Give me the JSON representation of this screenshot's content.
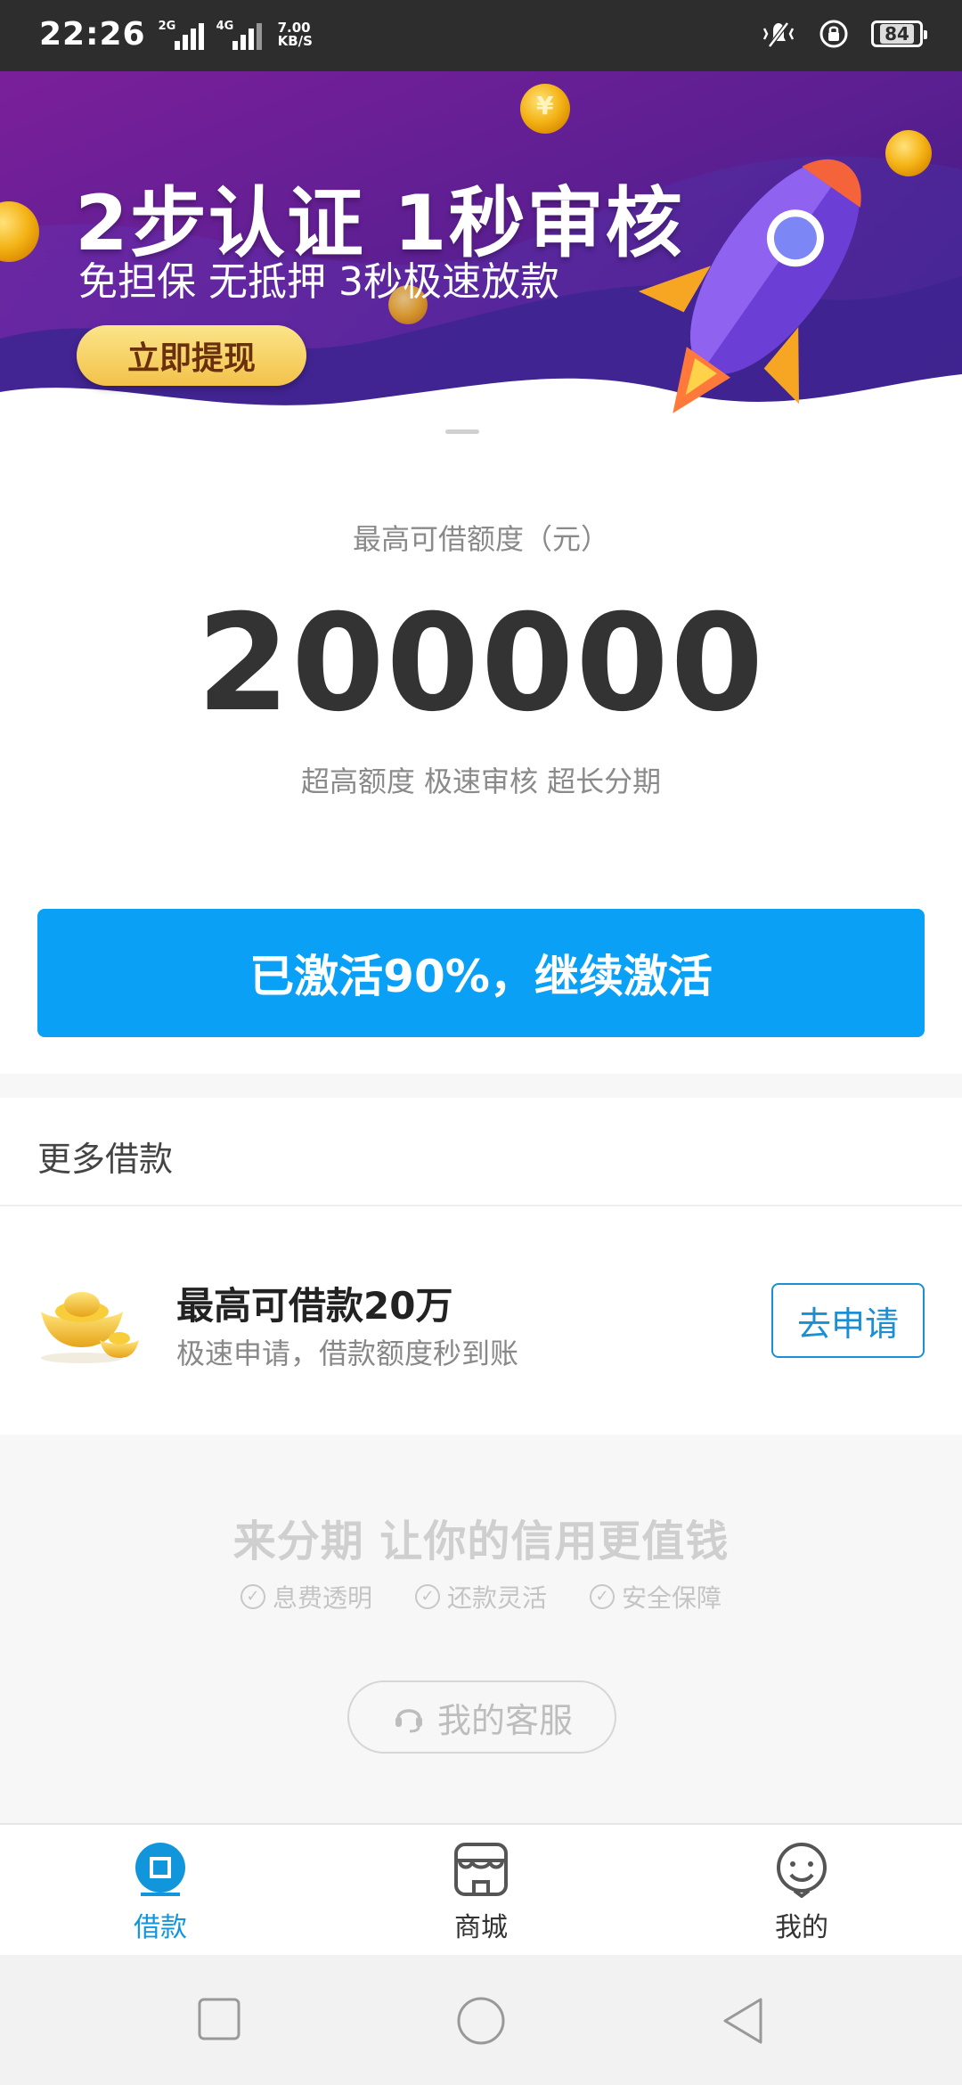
{
  "status_bar": {
    "time": "22:26",
    "signal1_label": "2G",
    "signal2_label": "4G",
    "speed_value": "7.00",
    "speed_unit": "KB/S",
    "battery": "84"
  },
  "banner": {
    "title": "2步认证 1秒审核",
    "subtitle": "免担保 无抵押 3秒极速放款",
    "button_label": "立即提现",
    "coin_symbol": "¥"
  },
  "credit": {
    "label": "最高可借额度（元）",
    "amount": "200000",
    "tags": "超高额度 极速审核 超长分期",
    "activate_label": "已激活90%，继续激活",
    "activation_progress_percent": 90
  },
  "more_loans": {
    "title": "更多借款",
    "item": {
      "title": "最高可借款20万",
      "desc": "极速申请，借款额度秒到账",
      "button": "去申请"
    }
  },
  "promo": {
    "slogan": "来分期 让你的信用更值钱",
    "features": [
      "息费透明",
      "还款灵活",
      "安全保障"
    ],
    "customer_service": "我的客服"
  },
  "tabbar": {
    "tabs": [
      {
        "label": "借款",
        "icon": "loan-icon",
        "active": true
      },
      {
        "label": "商城",
        "icon": "store-icon",
        "active": false
      },
      {
        "label": "我的",
        "icon": "profile-icon",
        "active": false
      }
    ]
  },
  "colors": {
    "accent": "#0aa0f6",
    "tab_active": "#1296db",
    "banner_purple": "#5a1f8f"
  }
}
